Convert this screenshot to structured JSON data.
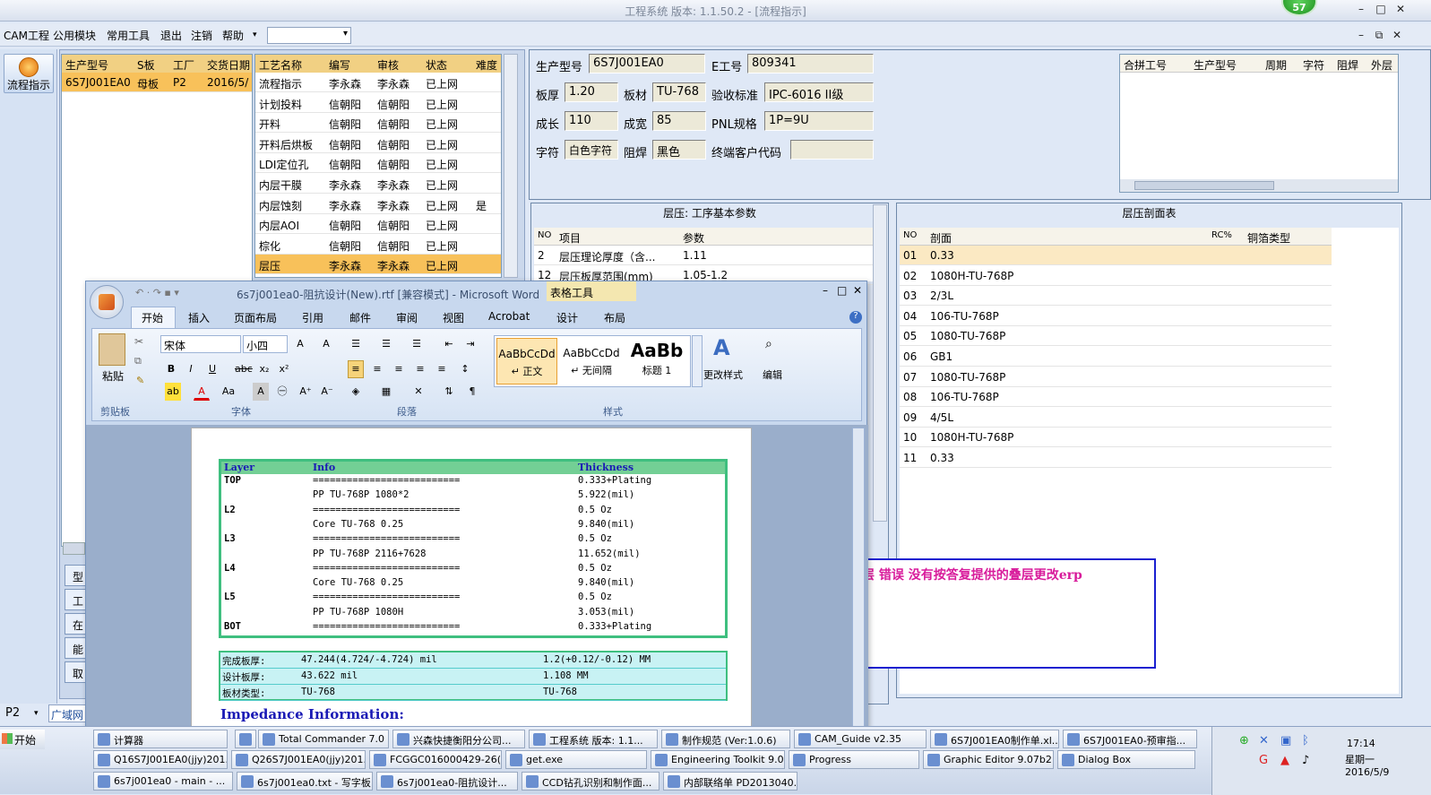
{
  "window": {
    "title": "工程系统  版本: 1.1.50.2 - [流程指示]",
    "badge": "57"
  },
  "menu": {
    "items": [
      "CAM工程",
      "公用模块",
      "常用工具",
      "退出",
      "注销",
      "帮助"
    ],
    "help_arrow": "▾"
  },
  "nav": {
    "flow_button": "流程指示",
    "side_tabs": [
      "型",
      "工",
      "在",
      "能",
      "取"
    ],
    "bottom_combo": "P2",
    "bottom_tab": "广域网"
  },
  "job_grid": {
    "headers": [
      "生产型号",
      "S板",
      "工厂",
      "交货日期"
    ],
    "rows": [
      [
        "6S7J001EA0",
        "母板",
        "P2",
        "2016/5/"
      ]
    ]
  },
  "process_grid": {
    "headers": [
      "工艺名称",
      "编写",
      "审核",
      "状态",
      "难度"
    ],
    "rows": [
      [
        "流程指示",
        "李永森",
        "李永森",
        "已上网",
        ""
      ],
      [
        "计划投料",
        "信朝阳",
        "信朝阳",
        "已上网",
        ""
      ],
      [
        "开料",
        "信朝阳",
        "信朝阳",
        "已上网",
        ""
      ],
      [
        "开料后烘板",
        "信朝阳",
        "信朝阳",
        "已上网",
        ""
      ],
      [
        "LDI定位孔",
        "信朝阳",
        "信朝阳",
        "已上网",
        ""
      ],
      [
        "内层干膜",
        "李永森",
        "李永森",
        "已上网",
        ""
      ],
      [
        "内层蚀刻",
        "李永森",
        "李永森",
        "已上网",
        "是"
      ],
      [
        "内层AOI",
        "信朝阳",
        "信朝阳",
        "已上网",
        ""
      ],
      [
        "棕化",
        "信朝阳",
        "信朝阳",
        "已上网",
        ""
      ],
      [
        "层压",
        "李永森",
        "李永森",
        "已上网",
        ""
      ]
    ]
  },
  "info": {
    "prod_label": "生产型号",
    "prod_value": "6S7J001EA0",
    "e_label": "E工号",
    "e_value": "809341",
    "thick_label": "板厚",
    "thick_value": "1.20",
    "mat_label": "板材",
    "mat_value": "TU-768",
    "std_label": "验收标准",
    "std_value": "IPC-6016 II级",
    "len_label": "成长",
    "len_value": "110",
    "wid_label": "成宽",
    "wid_value": "85",
    "pnl_label": "PNL规格",
    "pnl_value": "1P=9U",
    "char_label": "字符",
    "char_value": "白色字符",
    "mask_label": "阻焊",
    "mask_value": "黑色",
    "cust_label": "终端客户代码",
    "cust_value": ""
  },
  "merge_grid": {
    "headers": [
      "合拼工号",
      "生产型号",
      "周期",
      "字符",
      "阻焊",
      "外层"
    ]
  },
  "lam_params": {
    "title": "层压: 工序基本参数",
    "headers": [
      "NO",
      "项目",
      "参数"
    ],
    "rows": [
      [
        "2",
        "层压理论厚度（含...",
        "1.11"
      ],
      [
        "12",
        "层压板厚范围(mm)",
        "1.05-1.2"
      ]
    ]
  },
  "lam_section": {
    "title": "层压剖面表",
    "headers": [
      "NO",
      "剖面",
      "RC%",
      "铜箔类型"
    ],
    "rows": [
      [
        "01",
        "0.33"
      ],
      [
        "02",
        "1080H-TU-768P"
      ],
      [
        "03",
        "2/3L"
      ],
      [
        "04",
        "106-TU-768P"
      ],
      [
        "05",
        "1080-TU-768P"
      ],
      [
        "06",
        "GB1"
      ],
      [
        "07",
        "1080-TU-768P"
      ],
      [
        "08",
        "106-TU-768P"
      ],
      [
        "09",
        "4/5L"
      ],
      [
        "10",
        "1080H-TU-768P"
      ],
      [
        "11",
        "0.33"
      ]
    ]
  },
  "error_box": {
    "text": "叠层  错误   没有按答复提供的叠层更改erp"
  },
  "word": {
    "title": "6s7j001ea0-阻抗设计(New).rtf [兼容模式] - Microsoft Word",
    "table_tools": "表格工具",
    "tabs": [
      "开始",
      "插入",
      "页面布局",
      "引用",
      "邮件",
      "审阅",
      "视图",
      "Acrobat",
      "设计",
      "布局"
    ],
    "font_name": "宋体",
    "font_size": "小四",
    "paste": "粘贴",
    "groups": [
      "剪贴板",
      "字体",
      "段落",
      "样式"
    ],
    "styles": [
      {
        "sample": "AaBbCcDd",
        "name": "↵ 正文"
      },
      {
        "sample": "AaBbCcDd",
        "name": "↵ 无间隔"
      },
      {
        "sample": "AaBb",
        "name": "标题 1"
      }
    ],
    "change_styles": "更改样式",
    "edit": "编辑",
    "doc": {
      "h_layer": "Layer",
      "h_info": "Info",
      "h_thick": "Thickness",
      "lines": [
        [
          "TOP",
          "==========================",
          "0.333+Plating"
        ],
        [
          "",
          "PP     TU-768P    1080*2",
          "5.922(mil)"
        ],
        [
          "L2",
          "==========================",
          "0.5 Oz"
        ],
        [
          "",
          "Core     TU-768     0.25",
          "9.840(mil)"
        ],
        [
          "L3",
          "==========================",
          "0.5 Oz"
        ],
        [
          "",
          "PP     TU-768P     2116+7628",
          "11.652(mil)"
        ],
        [
          "L4",
          "==========================",
          "0.5 Oz"
        ],
        [
          "",
          "Core     TU-768     0.25",
          "9.840(mil)"
        ],
        [
          "L5",
          "==========================",
          "0.5 Oz"
        ],
        [
          "",
          "PP     TU-768P     1080H",
          "3.053(mil)"
        ],
        [
          "BOT",
          "==========================",
          "0.333+Plating"
        ]
      ],
      "summary": [
        [
          "完成板厚:",
          "47.244(4.724/-4.724) mil",
          "1.2(+0.12/-0.12) MM"
        ],
        [
          "设计板厚:",
          "43.622 mil",
          "1.108 MM"
        ],
        [
          "板材类型:",
          "TU-768",
          "TU-768"
        ]
      ],
      "impedance": "Impedance Information:"
    }
  },
  "taskbar": {
    "start": "开始",
    "row1": [
      "计算器",
      "",
      "Total Commander 7.0 ...",
      "兴森快捷衡阳分公司...",
      "工程系统  版本: 1.1...",
      "制作规范 (Ver:1.0.6)",
      "CAM_Guide v2.35",
      "6S7J001EA0制作单.xl...",
      "6S7J001EA0-预审指..."
    ],
    "row2": [
      "Q16S7J001EA0(jjy)201...",
      "Q26S7J001EA0(jjy)201...",
      "FCGGC016000429-26(6...",
      "get.exe",
      "Engineering Toolkit 9.07...",
      "Progress",
      "Graphic Editor 9.07b2 (...",
      "Dialog Box"
    ],
    "row3": [
      "6s7j001ea0 - main - ...",
      "6s7j001ea0.txt - 写字板",
      "6s7j001ea0-阻抗设计...",
      "CCD钻孔识别和制作面...",
      "内部联络单 PD2013040..."
    ],
    "time": "17:14",
    "day": "星期一",
    "date": "2016/5/9"
  }
}
